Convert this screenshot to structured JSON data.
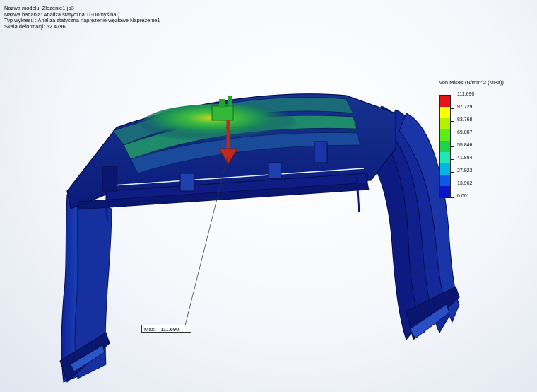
{
  "study_info": {
    "model_name": "Nazwa modelu: Złożenie1-jp3",
    "study_name": "Nazwa badania: Analiza statyczna 1(-Domyślna-)",
    "plot_type": "Typ wykresu : Analiza statyczna naprężenie węzłowe Naprężenie1",
    "deformation_scale": "Skala deformacji: 52.4796"
  },
  "legend": {
    "title": "von Mises (N/mm^2 (MPa))",
    "values": [
      "111.690",
      "97.729",
      "83.768",
      "69.807",
      "55.846",
      "41.884",
      "27.923",
      "13.962",
      "0.001"
    ],
    "colors": [
      "#e8131a",
      "#ffff00",
      "#b4f000",
      "#5aee14",
      "#1ed24a",
      "#1ee6b4",
      "#00b4e6",
      "#0a5ae6",
      "#0a14c8"
    ]
  },
  "max_annotation": {
    "label": "Max:",
    "value": "111.690"
  },
  "colors": {
    "structure_dark": "#0d1a86",
    "structure_mid": "#1a3fae",
    "hotspot": "#1e9a3c"
  }
}
